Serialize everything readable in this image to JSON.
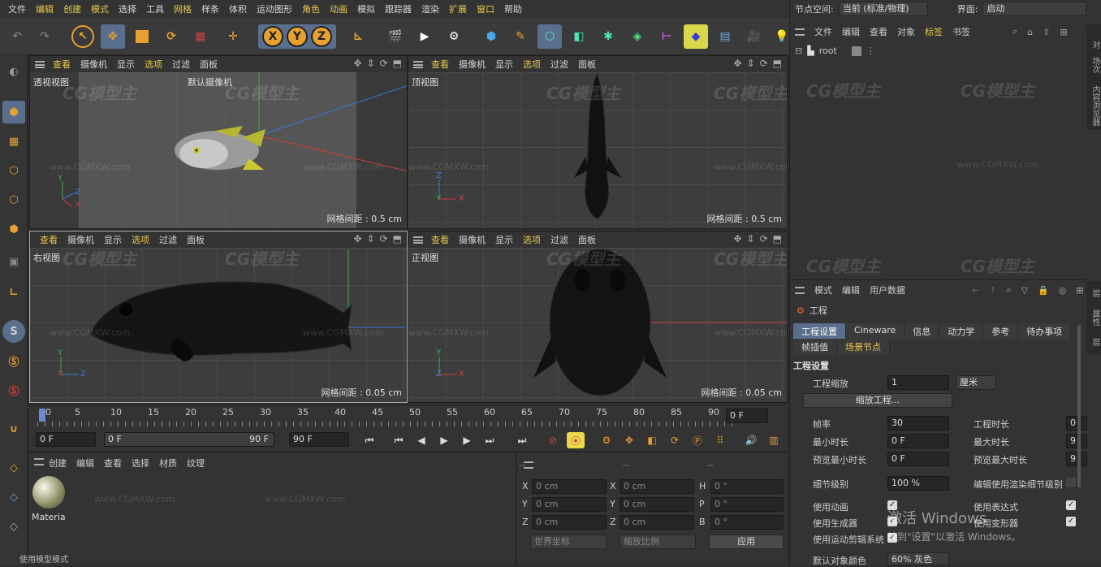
{
  "menubar": {
    "items": [
      "文件",
      "编辑",
      "创建",
      "模式",
      "选择",
      "工具",
      "网格",
      "样条",
      "体积",
      "运动图形",
      "角色",
      "动画",
      "模拟",
      "跟踪器",
      "渲染",
      "扩展",
      "窗口",
      "帮助"
    ]
  },
  "node_space": {
    "label": "节点空间:",
    "value": "当前 (标准/物理)"
  },
  "interface": {
    "label": "界面:",
    "value": "启动"
  },
  "viewport_menu": [
    "查看",
    "摄像机",
    "显示",
    "选项",
    "过滤",
    "面板"
  ],
  "viewports": {
    "perspective": {
      "name": "透视视图",
      "camera": "默认摄像机",
      "grid": "网格间距 : 0.5 cm"
    },
    "top": {
      "name": "顶视图",
      "grid": "网格间距 : 0.5 cm"
    },
    "right": {
      "name": "右视图",
      "grid": "网格间距 : 0.05 cm"
    },
    "front": {
      "name": "正视图",
      "grid": "网格间距 : 0.05 cm"
    }
  },
  "watermark": {
    "logo": "CG模型主",
    "url": "www.CGMXW.com"
  },
  "timeline": {
    "ticks": [
      "0",
      "5",
      "10",
      "15",
      "20",
      "25",
      "30",
      "35",
      "40",
      "45",
      "50",
      "55",
      "60",
      "65",
      "70",
      "75",
      "80",
      "85",
      "90"
    ],
    "current": "0 F",
    "start": "0 F",
    "range_start": "0 F",
    "range_end": "90 F",
    "end": "90 F"
  },
  "material_panel": {
    "menu": [
      "创建",
      "编辑",
      "查看",
      "选择",
      "材质",
      "纹理"
    ],
    "material_name": "Materia"
  },
  "coord_panel": {
    "header": [
      "--",
      "--",
      "--"
    ],
    "rows": [
      {
        "a": "X",
        "av": "0 cm",
        "b": "X",
        "bv": "0 cm",
        "c": "H",
        "cv": "0 °"
      },
      {
        "a": "Y",
        "av": "0 cm",
        "b": "Y",
        "bv": "0 cm",
        "c": "P",
        "cv": "0 °"
      },
      {
        "a": "Z",
        "av": "0 cm",
        "b": "Z",
        "bv": "0 cm",
        "c": "B",
        "cv": "0 °"
      }
    ],
    "world": "世界坐标",
    "scale": "缩放比例",
    "apply": "应用"
  },
  "object_manager": {
    "menu": [
      "文件",
      "编辑",
      "查看",
      "对象",
      "标签",
      "书签"
    ],
    "root": "root"
  },
  "attr_manager": {
    "menu": [
      "模式",
      "编辑",
      "用户数据"
    ],
    "title": "工程",
    "tabs_row1": [
      "工程设置",
      "Cineware",
      "信息",
      "动力学",
      "参考",
      "待办事项"
    ],
    "tabs_row2": [
      "帧插值",
      "场景节点"
    ],
    "section": "工程设置",
    "scale_label": "工程缩放",
    "scale_value": "1",
    "scale_unit": "厘米",
    "scale_button": "缩放工程...",
    "fps_label": "帧率",
    "fps_value": "30",
    "duration_label": "工程时长",
    "duration_value": "0",
    "min_label": "最小时长",
    "min_value": "0 F",
    "max_label": "最大时长",
    "max_value": "9",
    "pmin_label": "预览最小时长",
    "pmin_value": "0 F",
    "pmax_label": "预览最大时长",
    "pmax_value": "9",
    "lod_label": "细节级别",
    "lod_value": "100 %",
    "render_lod_label": "编辑使用渲染细节级别",
    "use_anim": "使用动画",
    "use_expr": "使用表达式",
    "use_gen": "使用生成器",
    "use_deform": "使用变形器",
    "use_motion": "使用运动剪辑系统",
    "default_color_label": "默认对象颜色",
    "default_color_value": "60% 灰色"
  },
  "activation": {
    "line1": "激活 Windows",
    "line2": "转到\"设置\"以激活 Windows。"
  },
  "status": "使用模型模式",
  "side_tabs": [
    "对象",
    "场次",
    "内容浏览器",
    "层",
    "属性",
    "层"
  ],
  "colors": {
    "accent": "#5a6f8e",
    "highlight": "#e8c94a",
    "axis_x": "#d03a3a",
    "axis_y": "#3ab04a",
    "axis_z": "#3a78d8"
  }
}
